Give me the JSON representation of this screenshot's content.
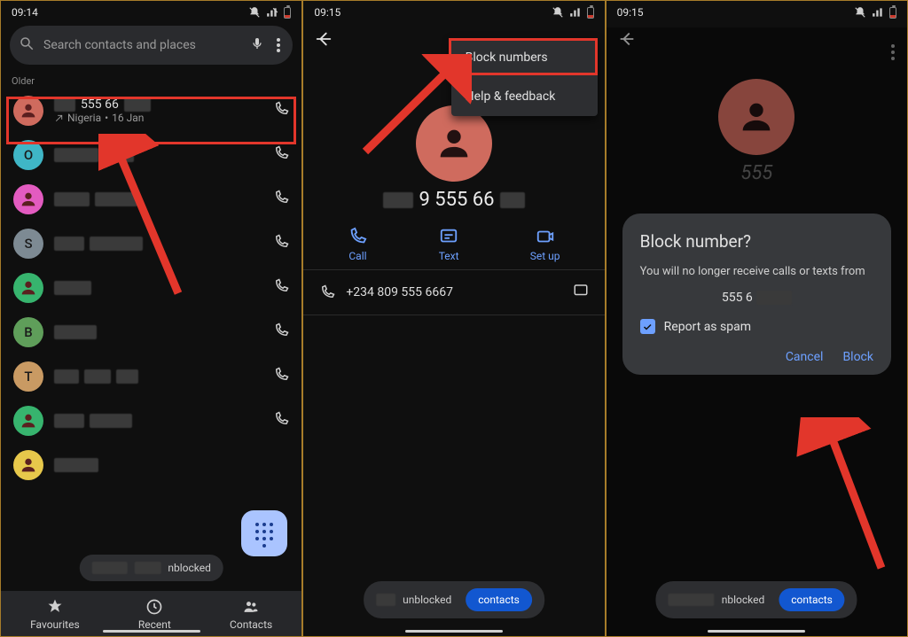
{
  "panel1": {
    "time": "09:14",
    "search_placeholder": "Search contacts and places",
    "older_label": "Older",
    "rows": [
      {
        "avatar_color": "#cf6b5e",
        "avatar_letter": "",
        "name": "555 66",
        "sub_loc": "Nigeria",
        "sub_date": "16 Jan"
      },
      {
        "avatar_color": "#3fb6c6",
        "avatar_letter": "O"
      },
      {
        "avatar_color": "#e35bc0",
        "avatar_letter": ""
      },
      {
        "avatar_color": "#7d8a93",
        "avatar_letter": "S"
      },
      {
        "avatar_color": "#37b46e",
        "avatar_letter": ""
      },
      {
        "avatar_color": "#5f9e5a",
        "avatar_letter": "B"
      },
      {
        "avatar_color": "#c99a63",
        "avatar_letter": "T"
      },
      {
        "avatar_color": "#37b46e",
        "avatar_letter": ""
      },
      {
        "avatar_color": "#e7c84b",
        "avatar_letter": ""
      }
    ],
    "nav": {
      "fav": "Favourites",
      "recent": "Recent",
      "contacts": "Contacts"
    },
    "toast_suffix": "nblocked"
  },
  "panel2": {
    "time": "09:15",
    "menu": {
      "block": "Block numbers",
      "help": "Help & feedback"
    },
    "number_visible": "9 555 66",
    "actions": {
      "call": "Call",
      "text": "Text",
      "setup": "Set up"
    },
    "full_number": "+234 809 555 6667",
    "toast_suffix": "unblocked",
    "toast_btn": "contacts"
  },
  "panel3": {
    "time": "09:15",
    "number_peek": "555",
    "dialog": {
      "title": "Block number?",
      "body": "You will no longer receive calls or texts from",
      "num": "555 6",
      "spam": "Report as spam",
      "cancel": "Cancel",
      "block": "Block"
    },
    "toast_suffix": "nblocked",
    "toast_btn": "contacts"
  }
}
